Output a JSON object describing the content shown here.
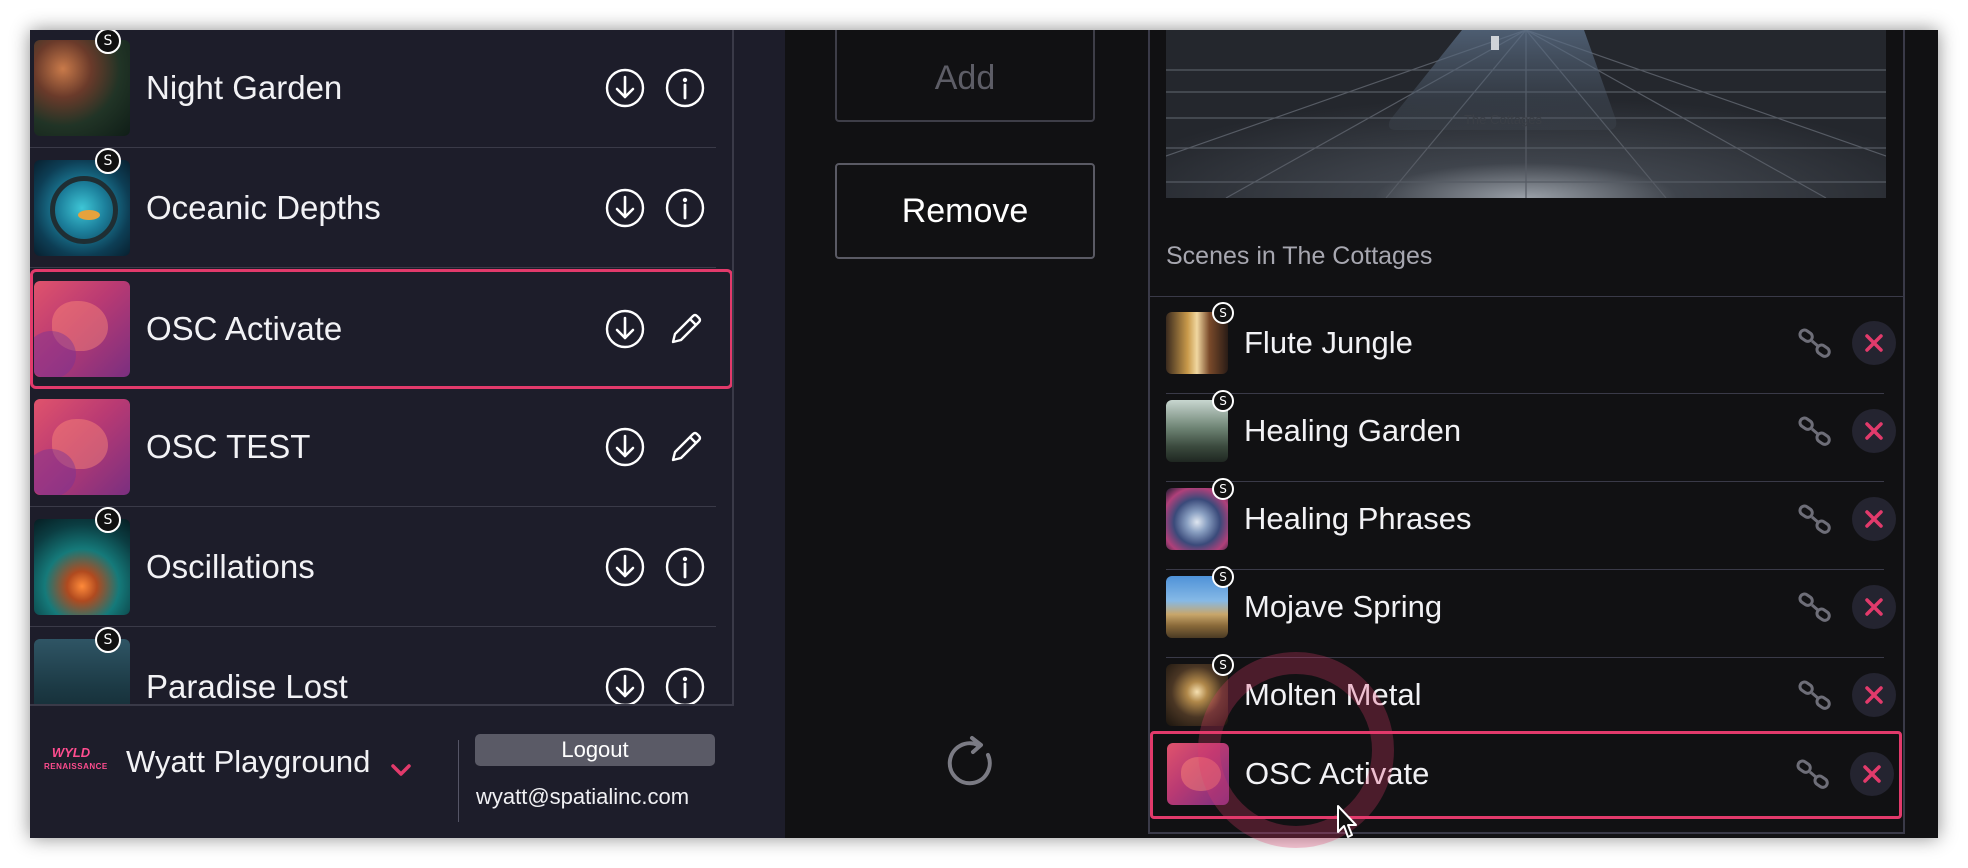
{
  "left_panel": {
    "scenes": [
      {
        "name": "Night Garden",
        "badge": "S",
        "action": "info"
      },
      {
        "name": "Oceanic Depths",
        "badge": "S",
        "action": "info"
      },
      {
        "name": "OSC Activate",
        "badge": "",
        "action": "edit",
        "selected": true
      },
      {
        "name": "OSC TEST",
        "badge": "",
        "action": "edit"
      },
      {
        "name": "Oscillations",
        "badge": "S",
        "action": "info"
      },
      {
        "name": "Paradise Lost",
        "badge": "S",
        "action": "info"
      }
    ]
  },
  "footer": {
    "logo_line1": "WYLD",
    "logo_line2": "RENAISSANCE",
    "workspace": "Wyatt Playground",
    "logout": "Logout",
    "email": "wyatt@spatialinc.com"
  },
  "middle": {
    "add": "Add",
    "remove": "Remove"
  },
  "right_panel": {
    "preview_label": "The Cottages",
    "section_title": "Scenes in The Cottages",
    "scenes": [
      {
        "name": "Flute Jungle",
        "badge": "S"
      },
      {
        "name": "Healing Garden",
        "badge": "S"
      },
      {
        "name": "Healing Phrases",
        "badge": "S"
      },
      {
        "name": "Mojave Spring",
        "badge": "S"
      },
      {
        "name": "Molten Metal",
        "badge": "S"
      },
      {
        "name": "OSC Activate",
        "badge": "",
        "selected": true
      }
    ]
  },
  "colors": {
    "accent": "#e23a6b",
    "panel_bg": "#1d1d2a",
    "dark_bg": "#111113"
  }
}
